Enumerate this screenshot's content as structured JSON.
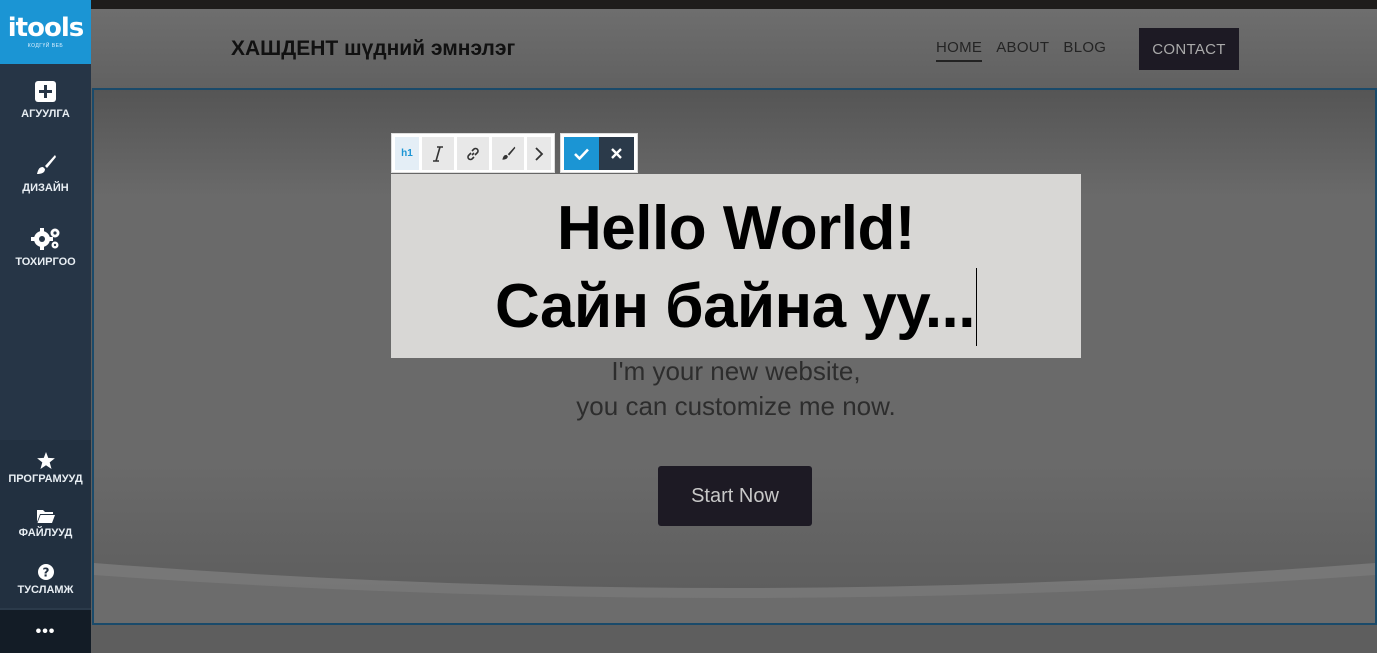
{
  "sidebar": {
    "logo": "itools",
    "logo_sub": "КОДГҮЙ ВЕБ",
    "top_items": [
      {
        "label": "АГУУЛГА",
        "icon": "plus-square-icon"
      },
      {
        "label": "ДИЗАЙН",
        "icon": "brush-icon"
      },
      {
        "label": "ТОХИРГОО",
        "icon": "gears-icon"
      }
    ],
    "bottom_items": [
      {
        "label": "ПРОГРАМУУД",
        "icon": "star-icon"
      },
      {
        "label": "ФАЙЛУУД",
        "icon": "folder-icon"
      },
      {
        "label": "ТУСЛАМЖ",
        "icon": "help-icon"
      }
    ],
    "more": "•••"
  },
  "header": {
    "title": "ХАШДЕНТ шүдний эмнэлэг",
    "nav": [
      "HOME",
      "ABOUT",
      "BLOG"
    ],
    "contact": "CONTACT"
  },
  "toolbar": {
    "h1": "h1"
  },
  "hero": {
    "heading_line1": "Hello World!",
    "heading_line2": "Сайн байна уу...",
    "subtitle_line1": "I'm your new website,",
    "subtitle_line2": "you can customize me now.",
    "button": "Start Now"
  },
  "colors": {
    "accent": "#1b95d4",
    "sidebar": "#2b3a4a",
    "dark_button": "#1d1a24"
  }
}
